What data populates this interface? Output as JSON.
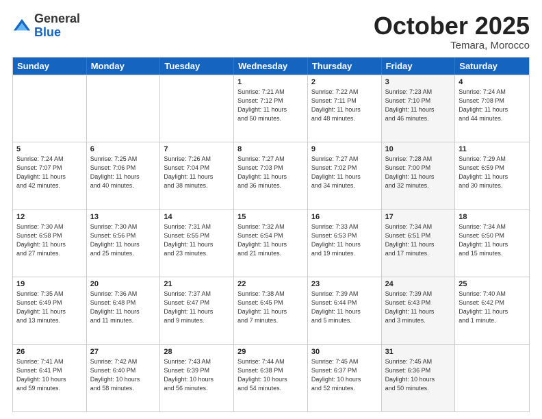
{
  "header": {
    "logo_general": "General",
    "logo_blue": "Blue",
    "month_title": "October 2025",
    "subtitle": "Temara, Morocco"
  },
  "calendar": {
    "days_of_week": [
      "Sunday",
      "Monday",
      "Tuesday",
      "Wednesday",
      "Thursday",
      "Friday",
      "Saturday"
    ],
    "rows": [
      [
        {
          "day": "",
          "info": "",
          "shaded": false
        },
        {
          "day": "",
          "info": "",
          "shaded": false
        },
        {
          "day": "",
          "info": "",
          "shaded": false
        },
        {
          "day": "1",
          "info": "Sunrise: 7:21 AM\nSunset: 7:12 PM\nDaylight: 11 hours\nand 50 minutes.",
          "shaded": false
        },
        {
          "day": "2",
          "info": "Sunrise: 7:22 AM\nSunset: 7:11 PM\nDaylight: 11 hours\nand 48 minutes.",
          "shaded": false
        },
        {
          "day": "3",
          "info": "Sunrise: 7:23 AM\nSunset: 7:10 PM\nDaylight: 11 hours\nand 46 minutes.",
          "shaded": true
        },
        {
          "day": "4",
          "info": "Sunrise: 7:24 AM\nSunset: 7:08 PM\nDaylight: 11 hours\nand 44 minutes.",
          "shaded": false
        }
      ],
      [
        {
          "day": "5",
          "info": "Sunrise: 7:24 AM\nSunset: 7:07 PM\nDaylight: 11 hours\nand 42 minutes.",
          "shaded": false
        },
        {
          "day": "6",
          "info": "Sunrise: 7:25 AM\nSunset: 7:06 PM\nDaylight: 11 hours\nand 40 minutes.",
          "shaded": false
        },
        {
          "day": "7",
          "info": "Sunrise: 7:26 AM\nSunset: 7:04 PM\nDaylight: 11 hours\nand 38 minutes.",
          "shaded": false
        },
        {
          "day": "8",
          "info": "Sunrise: 7:27 AM\nSunset: 7:03 PM\nDaylight: 11 hours\nand 36 minutes.",
          "shaded": false
        },
        {
          "day": "9",
          "info": "Sunrise: 7:27 AM\nSunset: 7:02 PM\nDaylight: 11 hours\nand 34 minutes.",
          "shaded": false
        },
        {
          "day": "10",
          "info": "Sunrise: 7:28 AM\nSunset: 7:00 PM\nDaylight: 11 hours\nand 32 minutes.",
          "shaded": true
        },
        {
          "day": "11",
          "info": "Sunrise: 7:29 AM\nSunset: 6:59 PM\nDaylight: 11 hours\nand 30 minutes.",
          "shaded": false
        }
      ],
      [
        {
          "day": "12",
          "info": "Sunrise: 7:30 AM\nSunset: 6:58 PM\nDaylight: 11 hours\nand 27 minutes.",
          "shaded": false
        },
        {
          "day": "13",
          "info": "Sunrise: 7:30 AM\nSunset: 6:56 PM\nDaylight: 11 hours\nand 25 minutes.",
          "shaded": false
        },
        {
          "day": "14",
          "info": "Sunrise: 7:31 AM\nSunset: 6:55 PM\nDaylight: 11 hours\nand 23 minutes.",
          "shaded": false
        },
        {
          "day": "15",
          "info": "Sunrise: 7:32 AM\nSunset: 6:54 PM\nDaylight: 11 hours\nand 21 minutes.",
          "shaded": false
        },
        {
          "day": "16",
          "info": "Sunrise: 7:33 AM\nSunset: 6:53 PM\nDaylight: 11 hours\nand 19 minutes.",
          "shaded": false
        },
        {
          "day": "17",
          "info": "Sunrise: 7:34 AM\nSunset: 6:51 PM\nDaylight: 11 hours\nand 17 minutes.",
          "shaded": true
        },
        {
          "day": "18",
          "info": "Sunrise: 7:34 AM\nSunset: 6:50 PM\nDaylight: 11 hours\nand 15 minutes.",
          "shaded": false
        }
      ],
      [
        {
          "day": "19",
          "info": "Sunrise: 7:35 AM\nSunset: 6:49 PM\nDaylight: 11 hours\nand 13 minutes.",
          "shaded": false
        },
        {
          "day": "20",
          "info": "Sunrise: 7:36 AM\nSunset: 6:48 PM\nDaylight: 11 hours\nand 11 minutes.",
          "shaded": false
        },
        {
          "day": "21",
          "info": "Sunrise: 7:37 AM\nSunset: 6:47 PM\nDaylight: 11 hours\nand 9 minutes.",
          "shaded": false
        },
        {
          "day": "22",
          "info": "Sunrise: 7:38 AM\nSunset: 6:45 PM\nDaylight: 11 hours\nand 7 minutes.",
          "shaded": false
        },
        {
          "day": "23",
          "info": "Sunrise: 7:39 AM\nSunset: 6:44 PM\nDaylight: 11 hours\nand 5 minutes.",
          "shaded": false
        },
        {
          "day": "24",
          "info": "Sunrise: 7:39 AM\nSunset: 6:43 PM\nDaylight: 11 hours\nand 3 minutes.",
          "shaded": true
        },
        {
          "day": "25",
          "info": "Sunrise: 7:40 AM\nSunset: 6:42 PM\nDaylight: 11 hours\nand 1 minute.",
          "shaded": false
        }
      ],
      [
        {
          "day": "26",
          "info": "Sunrise: 7:41 AM\nSunset: 6:41 PM\nDaylight: 10 hours\nand 59 minutes.",
          "shaded": false
        },
        {
          "day": "27",
          "info": "Sunrise: 7:42 AM\nSunset: 6:40 PM\nDaylight: 10 hours\nand 58 minutes.",
          "shaded": false
        },
        {
          "day": "28",
          "info": "Sunrise: 7:43 AM\nSunset: 6:39 PM\nDaylight: 10 hours\nand 56 minutes.",
          "shaded": false
        },
        {
          "day": "29",
          "info": "Sunrise: 7:44 AM\nSunset: 6:38 PM\nDaylight: 10 hours\nand 54 minutes.",
          "shaded": false
        },
        {
          "day": "30",
          "info": "Sunrise: 7:45 AM\nSunset: 6:37 PM\nDaylight: 10 hours\nand 52 minutes.",
          "shaded": false
        },
        {
          "day": "31",
          "info": "Sunrise: 7:45 AM\nSunset: 6:36 PM\nDaylight: 10 hours\nand 50 minutes.",
          "shaded": true
        },
        {
          "day": "",
          "info": "",
          "shaded": false
        }
      ]
    ]
  }
}
